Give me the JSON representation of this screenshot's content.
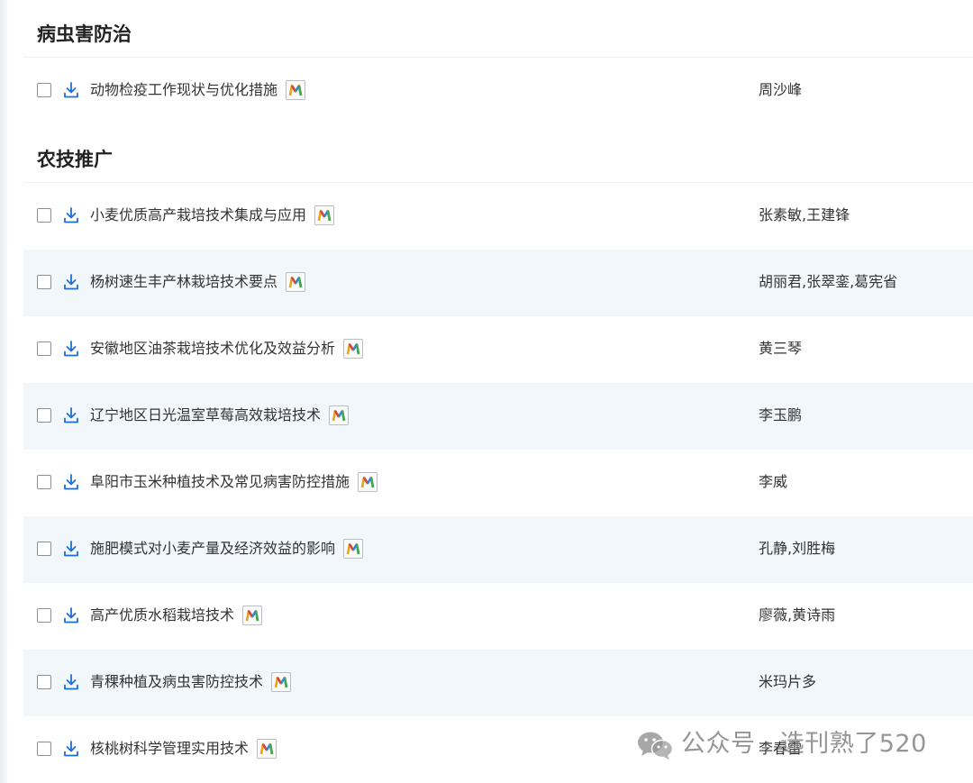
{
  "sections": [
    {
      "title": "病虫害防治",
      "rows": [
        {
          "title": "动物检疫工作现状与优化措施",
          "author": "周沙峰"
        }
      ]
    },
    {
      "title": "农技推广",
      "rows": [
        {
          "title": "小麦优质高产栽培技术集成与应用",
          "author": "张素敏,王建锋"
        },
        {
          "title": "杨树速生丰产林栽培技术要点",
          "author": "胡丽君,张翠銮,葛宪省"
        },
        {
          "title": "安徽地区油茶栽培技术优化及效益分析",
          "author": "黄三琴"
        },
        {
          "title": "辽宁地区日光温室草莓高效栽培技术",
          "author": "李玉鹏"
        },
        {
          "title": "阜阳市玉米种植技术及常见病害防控措施",
          "author": "李威"
        },
        {
          "title": "施肥模式对小麦产量及经济效益的影响",
          "author": "孔静,刘胜梅"
        },
        {
          "title": "高产优质水稻栽培技术",
          "author": "廖薇,黄诗雨"
        },
        {
          "title": "青稞种植及病虫害防控技术",
          "author": "米玛片多"
        },
        {
          "title": "核桃树科学管理实用技术",
          "author": "李春雷"
        }
      ]
    }
  ],
  "icons": {
    "download": "download-icon",
    "mindmap": "m-badge-icon",
    "checkbox": "checkbox"
  },
  "watermark": {
    "text": "公众号 · 选刊熟了520",
    "icon": "wechat-icon"
  },
  "colors": {
    "accent": "#1f6fd1",
    "row_alt_bg": "#f2f7fc",
    "text": "#333333",
    "heading": "#222222"
  }
}
